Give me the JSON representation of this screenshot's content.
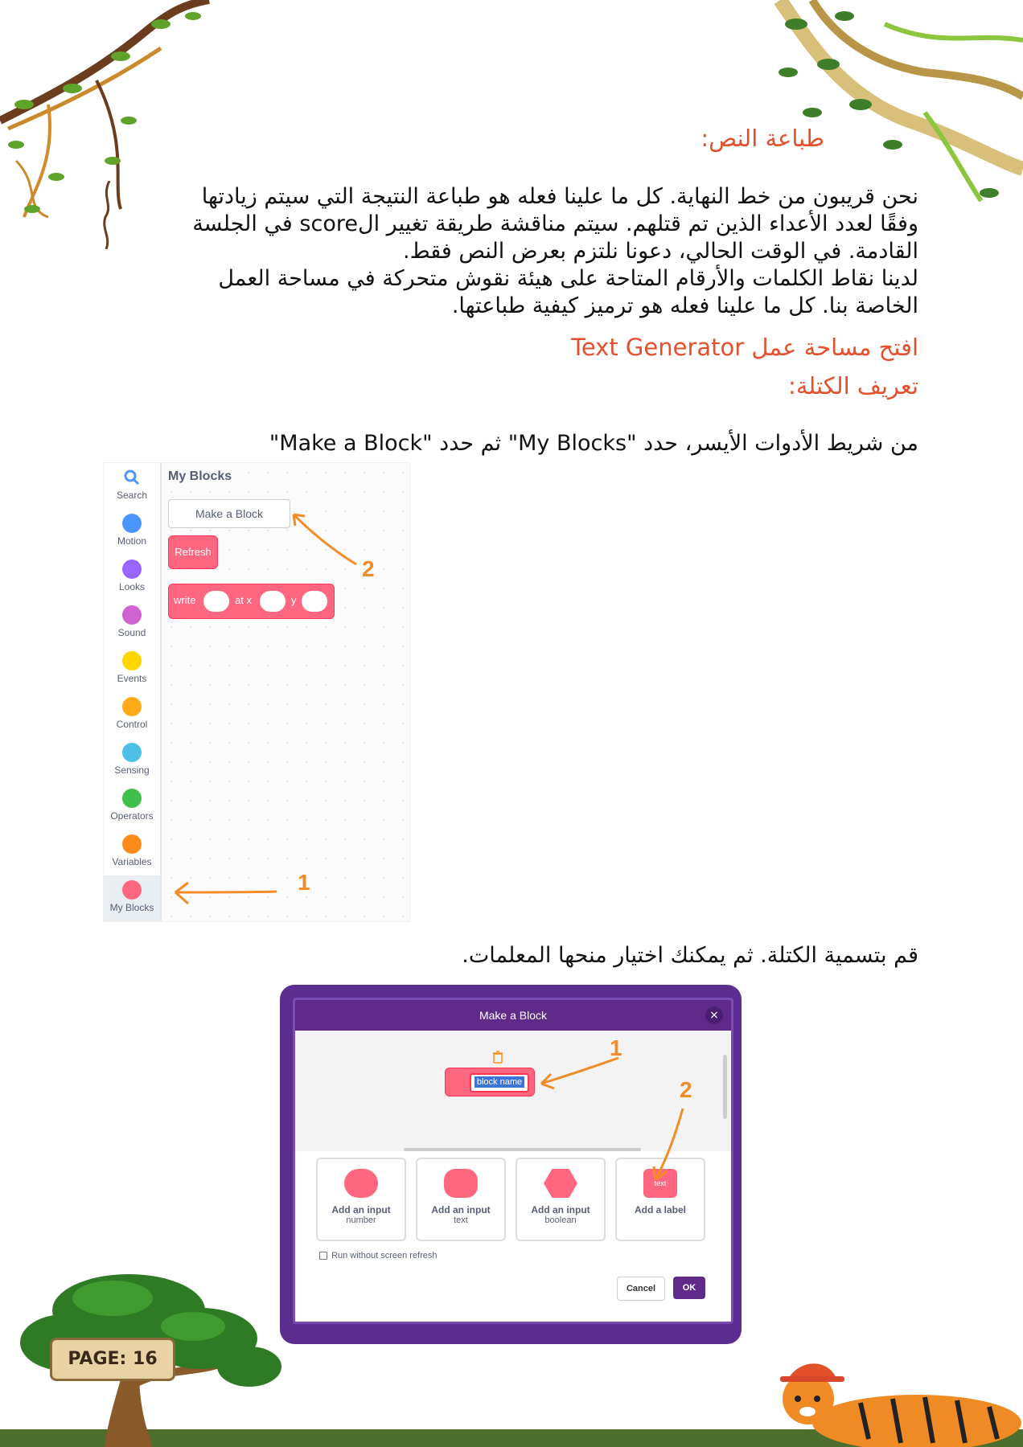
{
  "section": {
    "heading": "طباعة النص:",
    "paragraph_lines": [
      "نحن قريبون من خط النهاية. كل ما علينا فعله هو طباعة النتيجة التي سيتم زيادتها",
      "وفقًا لعدد الأعداء الذين تم قتلهم. سيتم مناقشة طريقة تغيير الscore في الجلسة",
      "القادمة. في الوقت الحالي، دعونا نلتزم بعرض النص فقط.",
      "لدينا نقاط الكلمات والأرقام المتاحة على هيئة نقوش متحركة في مساحة العمل",
      "الخاصة بنا. كل ما علينا فعله هو ترميز كيفية طباعتها."
    ],
    "open_workspace": "افتح مساحة عمل Text Generator",
    "define_block": "تعريف الكتلة:",
    "instruction1": "من شريط الأدوات الأيسر، حدد \"My Blocks\" ثم حدد \"Make a Block\"",
    "instruction2": "قم بتسمية الكتلة. ثم يمكنك اختيار منحها المعلمات."
  },
  "palette": {
    "categories": [
      {
        "label": "Search",
        "color": "#4c97ff"
      },
      {
        "label": "Motion",
        "color": "#4c97ff"
      },
      {
        "label": "Looks",
        "color": "#9966ff"
      },
      {
        "label": "Sound",
        "color": "#cf63cf"
      },
      {
        "label": "Events",
        "color": "#ffd500"
      },
      {
        "label": "Control",
        "color": "#ffab19"
      },
      {
        "label": "Sensing",
        "color": "#4cbfe6"
      },
      {
        "label": "Operators",
        "color": "#40bf4a"
      },
      {
        "label": "Variables",
        "color": "#ff8c1a"
      },
      {
        "label": "My Blocks",
        "color": "#ff6680"
      }
    ],
    "title": "My Blocks",
    "make_block_button": "Make a Block",
    "refresh_block": "Refresh",
    "write_block": {
      "write": "write",
      "at_x": "at x",
      "y": "y"
    },
    "annotation_1": "1",
    "annotation_2": "2"
  },
  "dialog": {
    "title": "Make a Block",
    "close": "×",
    "block_name_placeholder": "block name",
    "options": [
      {
        "title": "Add an input",
        "subtitle": "number"
      },
      {
        "title": "Add an input",
        "subtitle": "text"
      },
      {
        "title": "Add an input",
        "subtitle": "boolean"
      },
      {
        "title": "Add a label",
        "subtitle": "",
        "icon_text": "text"
      }
    ],
    "run_without_refresh": "Run without screen refresh",
    "cancel": "Cancel",
    "ok": "OK",
    "annotation_1": "1",
    "annotation_2": "2"
  },
  "footer": {
    "page_label": "PAGE: 16"
  },
  "colors": {
    "heading": "#e2512c",
    "annotation": "#f28c28",
    "dialog_header": "#5f2a8a",
    "block_pink": "#ff6680"
  }
}
